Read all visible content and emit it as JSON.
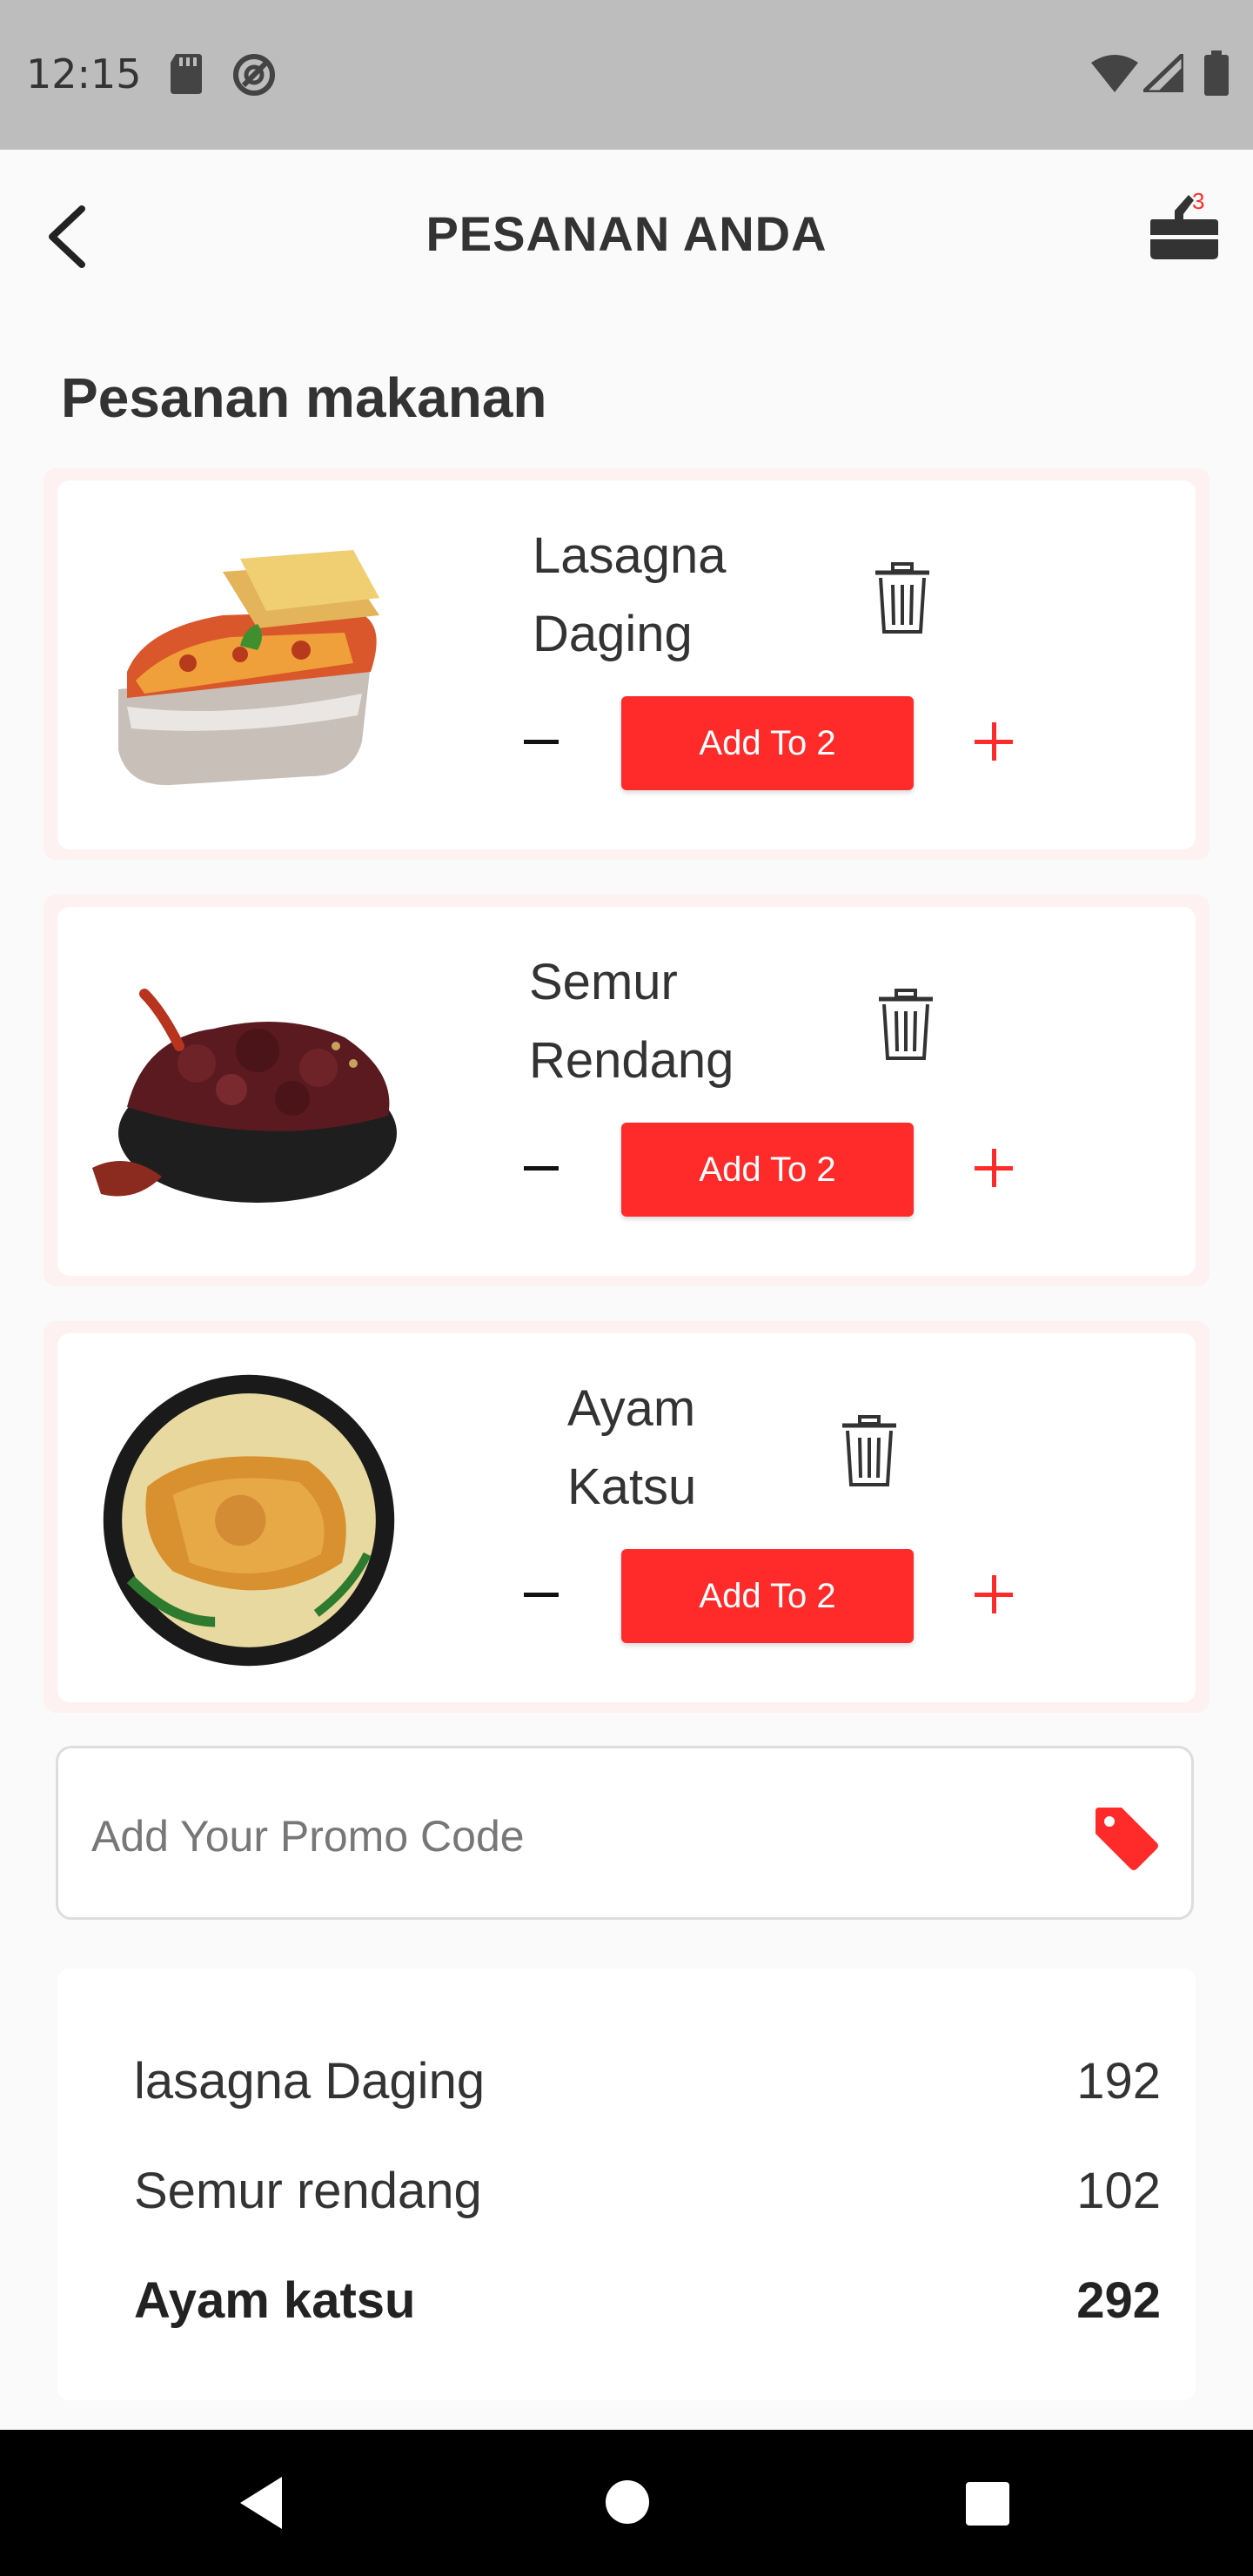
{
  "status_bar": {
    "time": "12:15"
  },
  "app_bar": {
    "title": "PESANAN ANDA",
    "cart_badge": "3"
  },
  "section_title": "Pesanan makanan",
  "orders": [
    {
      "name": "Lasagna Daging",
      "button_label": "Add To 2",
      "image": "lasagna-image"
    },
    {
      "name": "Semur Rendang",
      "button_label": "Add To 2",
      "image": "rendang-image"
    },
    {
      "name": "Ayam Katsu",
      "button_label": "Add To 2",
      "image": "katsu-image"
    }
  ],
  "promo": {
    "placeholder": "Add Your Promo Code",
    "icon": "tag-icon"
  },
  "summary": [
    {
      "name": "lasagna Daging",
      "price": "192"
    },
    {
      "name": "Semur rendang",
      "price": "102"
    },
    {
      "name": "Ayam katsu",
      "price": "292"
    }
  ],
  "colors": {
    "accent": "#ff2b2b",
    "status_bar": "#bdbdbd",
    "nav_bar": "#000000"
  }
}
